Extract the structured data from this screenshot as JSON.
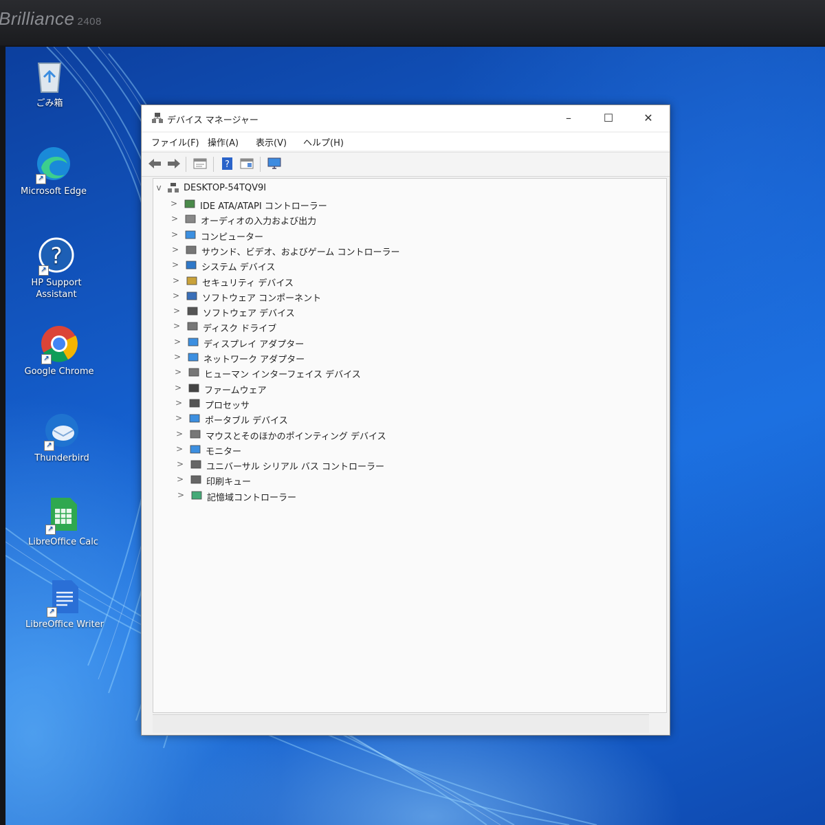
{
  "monitor": {
    "brand": "Brilliance",
    "model": "2408"
  },
  "desktop": {
    "icons": [
      {
        "label": "ごみ箱",
        "icon": "recycle-bin-icon"
      },
      {
        "label": "Microsoft Edge",
        "icon": "edge-icon"
      },
      {
        "label": "HP Support Assistant",
        "icon": "hp-support-icon"
      },
      {
        "label": "Google Chrome",
        "icon": "chrome-icon"
      },
      {
        "label": "Thunderbird",
        "icon": "thunderbird-icon"
      },
      {
        "label": "LibreOffice Calc",
        "icon": "libreoffice-calc-icon"
      },
      {
        "label": "LibreOffice Writer",
        "icon": "libreoffice-writer-icon"
      }
    ]
  },
  "window": {
    "title": "デバイス マネージャー",
    "controls": {
      "minimize": "–",
      "maximize": "☐",
      "close": "✕"
    },
    "menu": [
      "ファイル(F)",
      "操作(A)",
      "表示(V)",
      "ヘルプ(H)"
    ],
    "toolbar": [
      "back-icon",
      "forward-icon",
      "properties-icon",
      "help-icon",
      "view-icon",
      "monitor-icon"
    ]
  },
  "tree": {
    "root": "DESKTOP-54TQV9I",
    "root_chevron": "v",
    "chevron": ">",
    "categories": [
      "IDE ATA/ATAPI コントローラー",
      "オーディオの入力および出力",
      "コンピューター",
      "サウンド、ビデオ、およびゲーム コントローラー",
      "システム デバイス",
      "セキュリティ デバイス",
      "ソフトウェア コンポーネント",
      "ソフトウェア デバイス",
      "ディスク ドライブ",
      "ディスプレイ アダプター",
      "ネットワーク アダプター",
      "ヒューマン インターフェイス デバイス",
      "ファームウェア",
      "プロセッサ",
      "ポータブル デバイス",
      "マウスとそのほかのポインティング デバイス",
      "モニター",
      "ユニバーサル シリアル バス コントローラー",
      "印刷キュー",
      "記憶域コントローラー"
    ]
  },
  "colors": {
    "accent": "#1560cf",
    "window_bg": "#f1f1f1"
  }
}
